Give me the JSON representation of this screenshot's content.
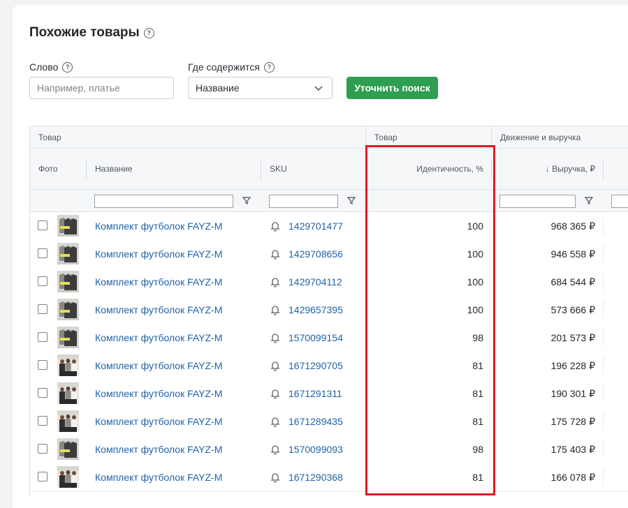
{
  "page": {
    "title": "Похожие товары",
    "help_glyph": "?"
  },
  "filters": {
    "word_label": "Слово",
    "word_placeholder": "Например, платье",
    "where_label": "Где содержится",
    "where_value": "Название",
    "refine_button": "Уточнить поиск"
  },
  "table": {
    "groups": [
      "Товар",
      "Товар",
      "Движение и выручка"
    ],
    "columns": {
      "photo": "Фото",
      "name": "Название",
      "sku": "SKU",
      "identity": "Идентичность, %",
      "revenue": "↓ Выручка, ₽"
    },
    "rows": [
      {
        "name": "Комплект футболок FAYZ-M",
        "sku": "1429701477",
        "identity": "100",
        "revenue": "968 365 ₽",
        "thumb": "gray-shirts"
      },
      {
        "name": "Комплект футболок FAYZ-M",
        "sku": "1429708656",
        "identity": "100",
        "revenue": "946 558 ₽",
        "thumb": "gray-shirts"
      },
      {
        "name": "Комплект футболок FAYZ-M",
        "sku": "1429704112",
        "identity": "100",
        "revenue": "684 544 ₽",
        "thumb": "gray-shirts"
      },
      {
        "name": "Комплект футболок FAYZ-M",
        "sku": "1429657395",
        "identity": "100",
        "revenue": "573 666 ₽",
        "thumb": "gray-shirts"
      },
      {
        "name": "Комплект футболок FAYZ-M",
        "sku": "1570099154",
        "identity": "98",
        "revenue": "201 573 ₽",
        "thumb": "gray-shirts"
      },
      {
        "name": "Комплект футболок FAYZ-M",
        "sku": "1671290705",
        "identity": "81",
        "revenue": "196 228 ₽",
        "thumb": "models"
      },
      {
        "name": "Комплект футболок FAYZ-M",
        "sku": "1671291311",
        "identity": "81",
        "revenue": "190 301 ₽",
        "thumb": "models"
      },
      {
        "name": "Комплект футболок FAYZ-M",
        "sku": "1671289435",
        "identity": "81",
        "revenue": "175 728 ₽",
        "thumb": "models"
      },
      {
        "name": "Комплект футболок FAYZ-M",
        "sku": "1570099093",
        "identity": "98",
        "revenue": "175 403 ₽",
        "thumb": "gray-shirts"
      },
      {
        "name": "Комплект футболок FAYZ-M",
        "sku": "1671290368",
        "identity": "81",
        "revenue": "166 078 ₽",
        "thumb": "models"
      }
    ]
  },
  "colors": {
    "accent_green": "#2e9e50",
    "link_blue": "#1f62a8",
    "highlight_red": "#e01b24"
  }
}
